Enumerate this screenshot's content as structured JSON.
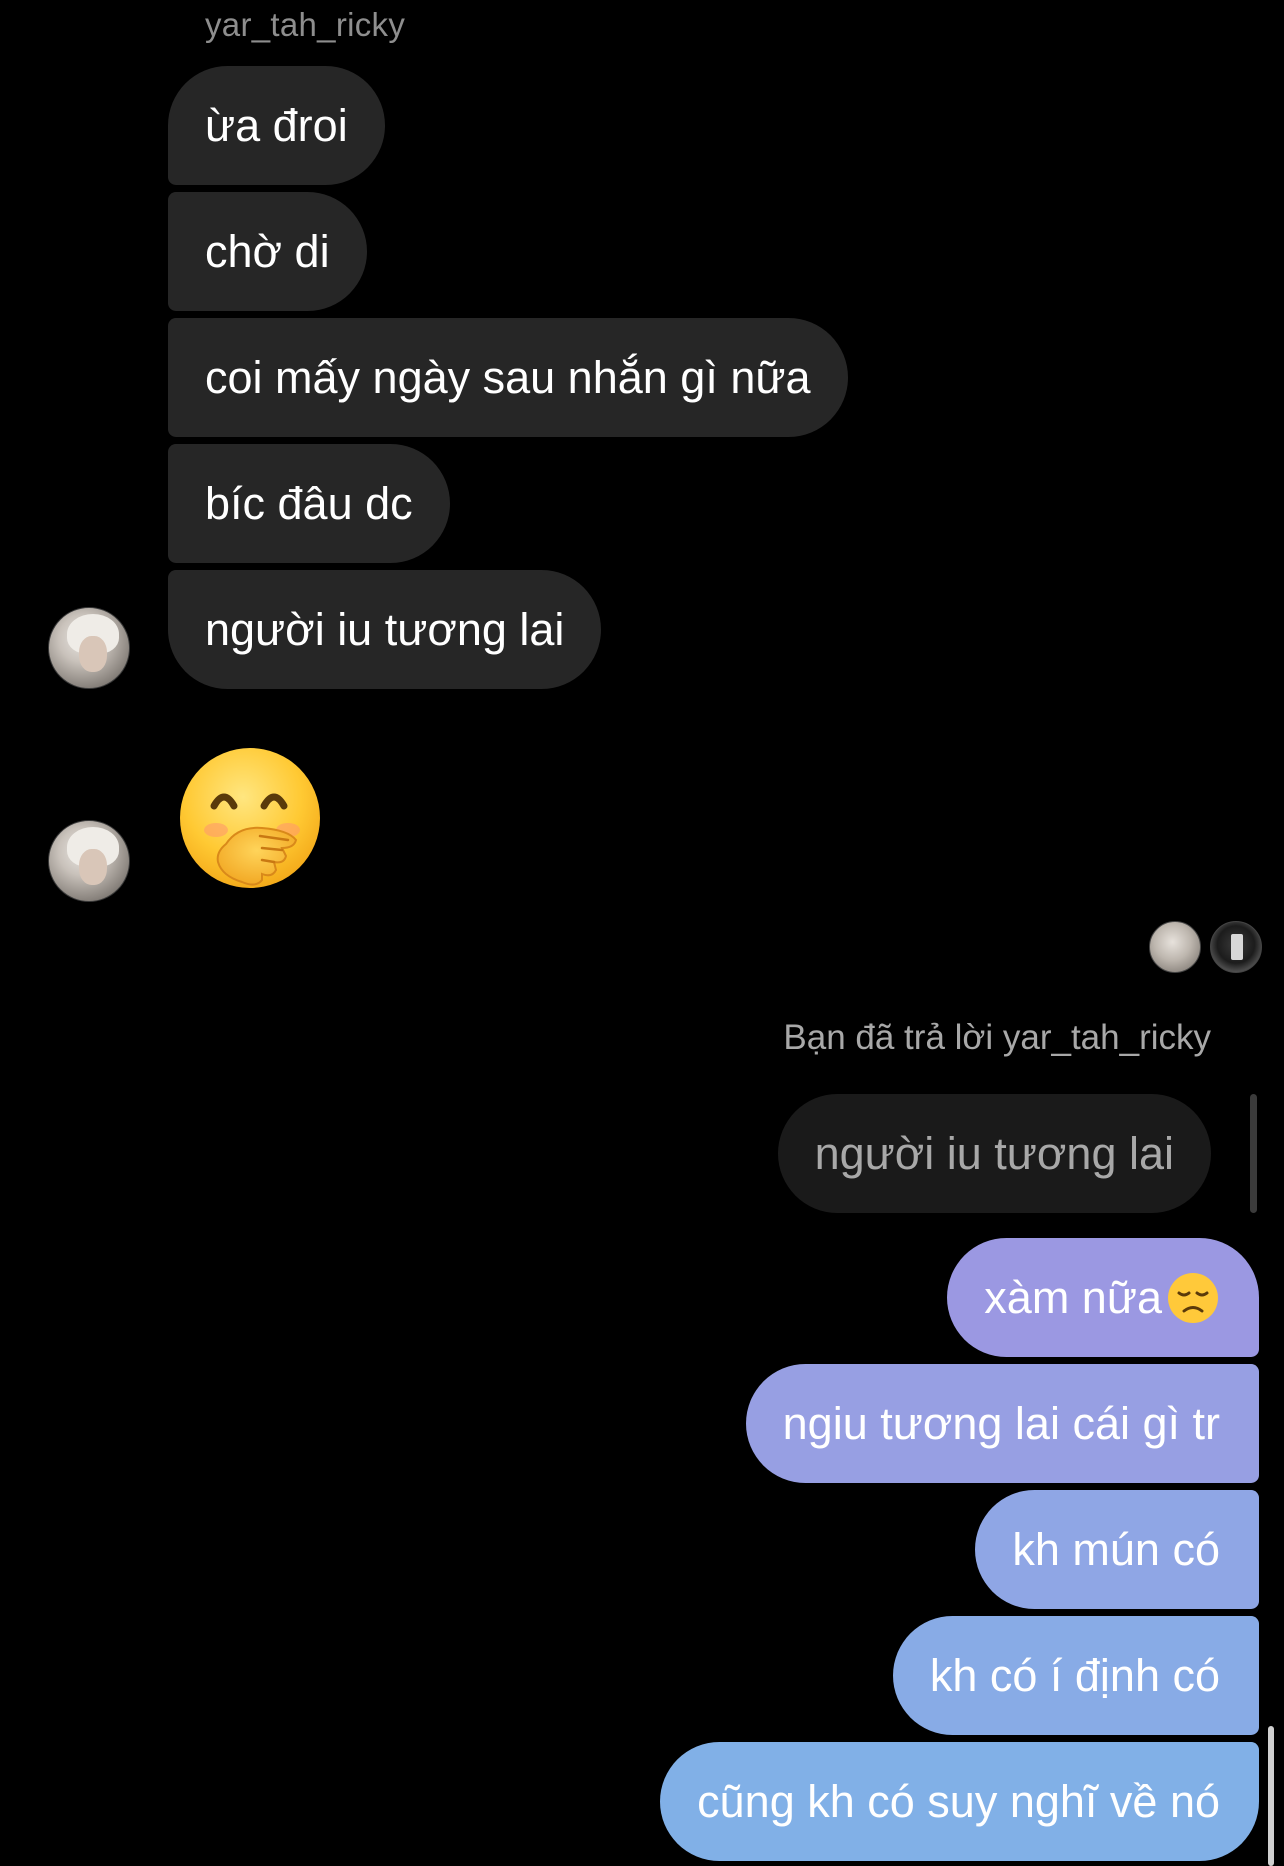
{
  "thread": {
    "sender_name": "yar_tah_ricky"
  },
  "incoming": [
    {
      "text": "ừa đroi"
    },
    {
      "text": "chờ di"
    },
    {
      "text": "coi mấy ngày sau nhắn gì nữa"
    },
    {
      "text": "bíc đâu dc"
    },
    {
      "text": "người iu tương lai"
    }
  ],
  "incoming_emoji": {
    "icon": "hand-over-mouth-emoji"
  },
  "reply": {
    "label": "Bạn đã trả lời yar_tah_ricky",
    "quoted_text": "người iu tương lai"
  },
  "outgoing": [
    {
      "text": "xàm nữa"
    },
    {
      "text": "ngiu tương lai cái gì tr"
    },
    {
      "text": "kh mún có"
    },
    {
      "text": "kh có í định có"
    },
    {
      "text": "cũng kh có suy nghĩ về nó"
    }
  ],
  "colors": {
    "background": "#000000",
    "incoming_bubble": "#262626",
    "outgoing_gradient_top": "#9d95e3",
    "outgoing_gradient_bottom": "#7fb0e6"
  }
}
